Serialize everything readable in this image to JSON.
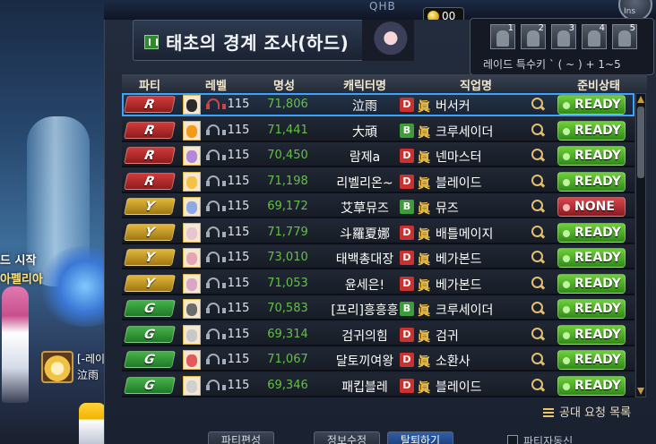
{
  "top": {
    "server": "QHB",
    "gold": "00",
    "ins_label": "Ins"
  },
  "keys": {
    "slots": [
      "1",
      "2",
      "3",
      "4",
      "5"
    ],
    "label": "레이드 특수키 ` ( ~ ) + 1~5"
  },
  "title": "태초의 경계 조사(하드)",
  "headers": [
    "파티",
    "레벨",
    "명성",
    "캐릭터명",
    "직업명",
    "준비상태"
  ],
  "rows": [
    {
      "party": "R",
      "level": "115",
      "fame": "71,806",
      "name": "泣雨",
      "grade": "D",
      "tag": "眞",
      "job": "버서커",
      "status": "READY",
      "selected": true,
      "muted": true,
      "face": "#2a2a2a"
    },
    {
      "party": "R",
      "level": "115",
      "fame": "71,441",
      "name": "大頑",
      "grade": "B",
      "tag": "眞",
      "job": "크루세이더",
      "status": "READY",
      "face": "#f39a1b"
    },
    {
      "party": "R",
      "level": "115",
      "fame": "70,450",
      "name": "람제a",
      "grade": "D",
      "tag": "眞",
      "job": "넨마스터",
      "status": "READY",
      "face": "#b488d8"
    },
    {
      "party": "R",
      "level": "115",
      "fame": "71,198",
      "name": "리벨리온~",
      "grade": "D",
      "tag": "眞",
      "job": "블레이드",
      "status": "READY",
      "face": "#f1c244"
    },
    {
      "party": "Y",
      "level": "115",
      "fame": "69,172",
      "name": "艾草뮤즈",
      "grade": "B",
      "tag": "眞",
      "job": "뮤즈",
      "status": "NONE",
      "face": "#8fa8e6"
    },
    {
      "party": "Y",
      "level": "115",
      "fame": "71,779",
      "name": "斗羅夏娜",
      "grade": "D",
      "tag": "眞",
      "job": "배틀메이지",
      "status": "READY",
      "face": "#e6c4d0"
    },
    {
      "party": "Y",
      "level": "115",
      "fame": "73,010",
      "name": "태백총대장",
      "grade": "D",
      "tag": "眞",
      "job": "베가본드",
      "status": "READY",
      "face": "#e3a7b2"
    },
    {
      "party": "Y",
      "level": "115",
      "fame": "71,053",
      "name": "윤세은!",
      "grade": "D",
      "tag": "眞",
      "job": "베가본드",
      "status": "READY",
      "face": "#d9a6c5"
    },
    {
      "party": "G",
      "level": "115",
      "fame": "70,583",
      "name": "[프리]흥흥흥",
      "grade": "B",
      "tag": "眞",
      "job": "크루세이더",
      "status": "READY",
      "face": "#6b6b6b"
    },
    {
      "party": "G",
      "level": "115",
      "fame": "69,314",
      "name": "검귀의힘",
      "grade": "D",
      "tag": "眞",
      "job": "검귀",
      "status": "READY",
      "face": "#c8c8c8"
    },
    {
      "party": "G",
      "level": "115",
      "fame": "71,067",
      "name": "달토끼여왕",
      "grade": "D",
      "tag": "眞",
      "job": "소환사",
      "status": "READY",
      "face": "#e25a5a"
    },
    {
      "party": "G",
      "level": "115",
      "fame": "69,346",
      "name": "패킵블레",
      "grade": "D",
      "tag": "眞",
      "job": "블레이드",
      "status": "READY",
      "face": "#d0d0d0"
    }
  ],
  "footer": {
    "request_label": "공대 요청 목록",
    "btn_party_edit": "파티편성",
    "btn_info": "정보수정",
    "btn_leave": "탈퇴하기",
    "auto_label": "파티자동신"
  },
  "background": {
    "line1": "드 시작",
    "line2": "아펠리아",
    "line3": "[-레이",
    "line4": "泣雨"
  },
  "colors": {
    "ready": "#3fae24",
    "none": "#c0303a",
    "fame": "#64c046",
    "party_R": "#c12e2e",
    "party_Y": "#caa126",
    "party_G": "#36a13b"
  }
}
